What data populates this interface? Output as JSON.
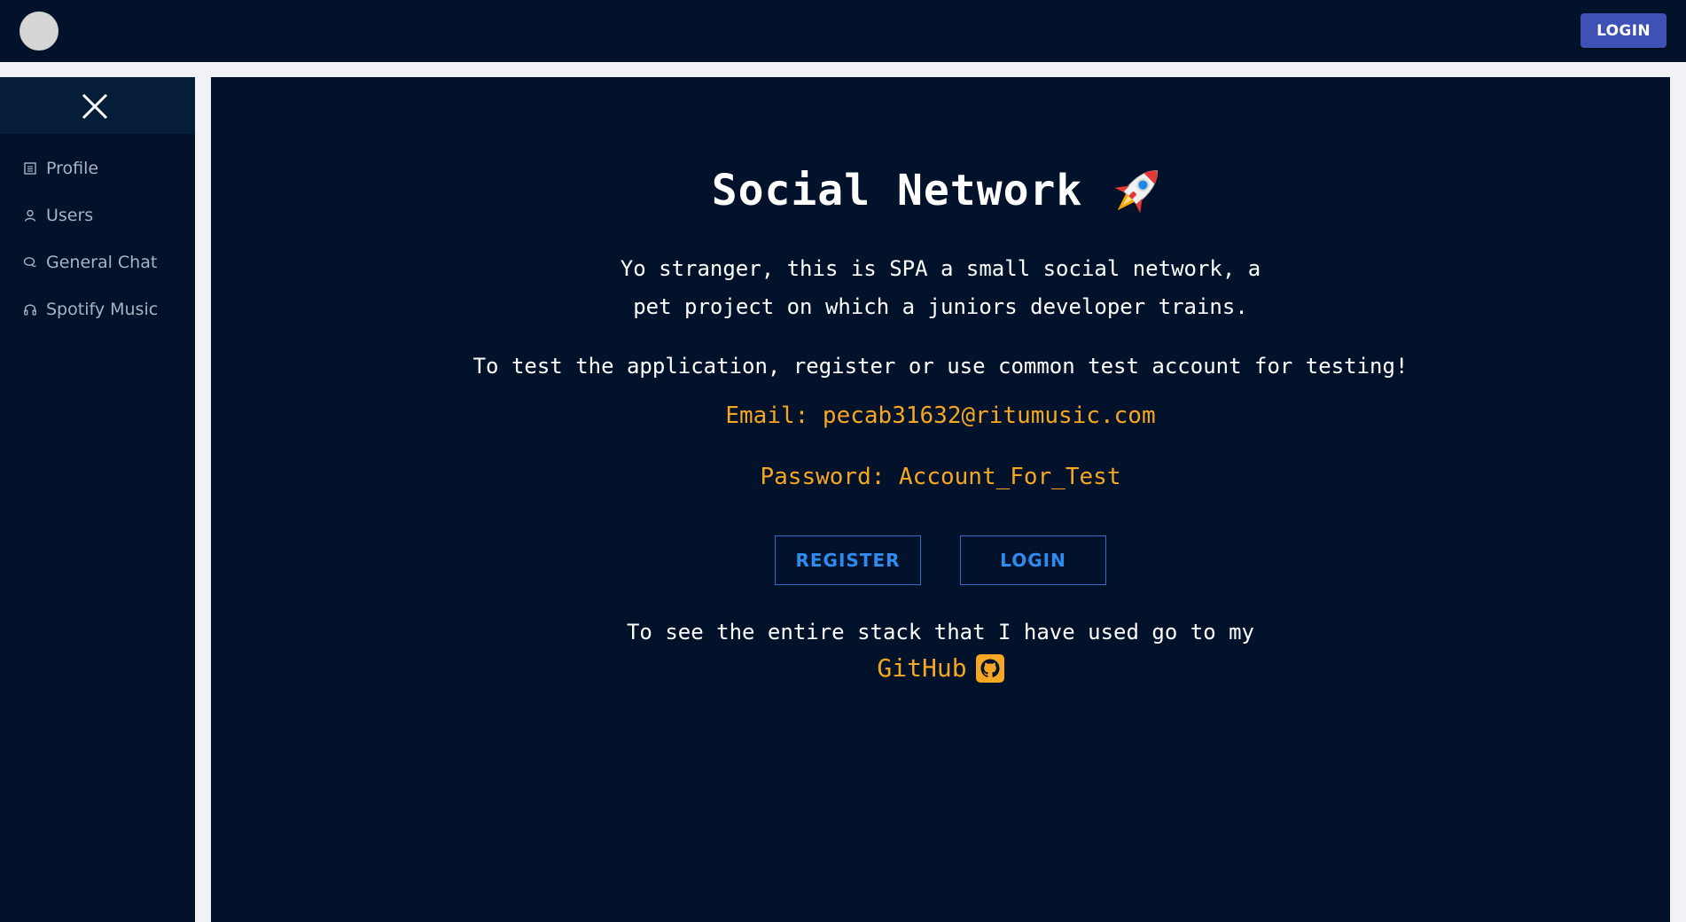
{
  "header": {
    "login_label": "LOGIN"
  },
  "sidebar": {
    "items": [
      {
        "label": "Profile",
        "icon": "profile-icon"
      },
      {
        "label": "Users",
        "icon": "user-icon"
      },
      {
        "label": "General Chat",
        "icon": "chat-icon"
      },
      {
        "label": "Spotify Music",
        "icon": "headphones-icon"
      }
    ]
  },
  "main": {
    "title": "Social Network",
    "title_icon": "rocket-icon",
    "intro": "Yo stranger, this is SPA a small social network, a pet project on which a juniors developer trains.",
    "testing": "To test the application, register or use common test account for testing!",
    "email": "Email: pecab31632@ritumusic.com",
    "password": "Password: Account_For_Test",
    "register_label": "REGISTER",
    "login_label": "LOGIN",
    "stack_text": "To see the entire stack that I have used go to my",
    "github_label": "GitHub",
    "github_icon": "github-icon"
  },
  "colors": {
    "background": "#02122a",
    "accent": "#f5a623",
    "primary_button": "#3f51b5",
    "outline_button": "#2f8bf0"
  }
}
